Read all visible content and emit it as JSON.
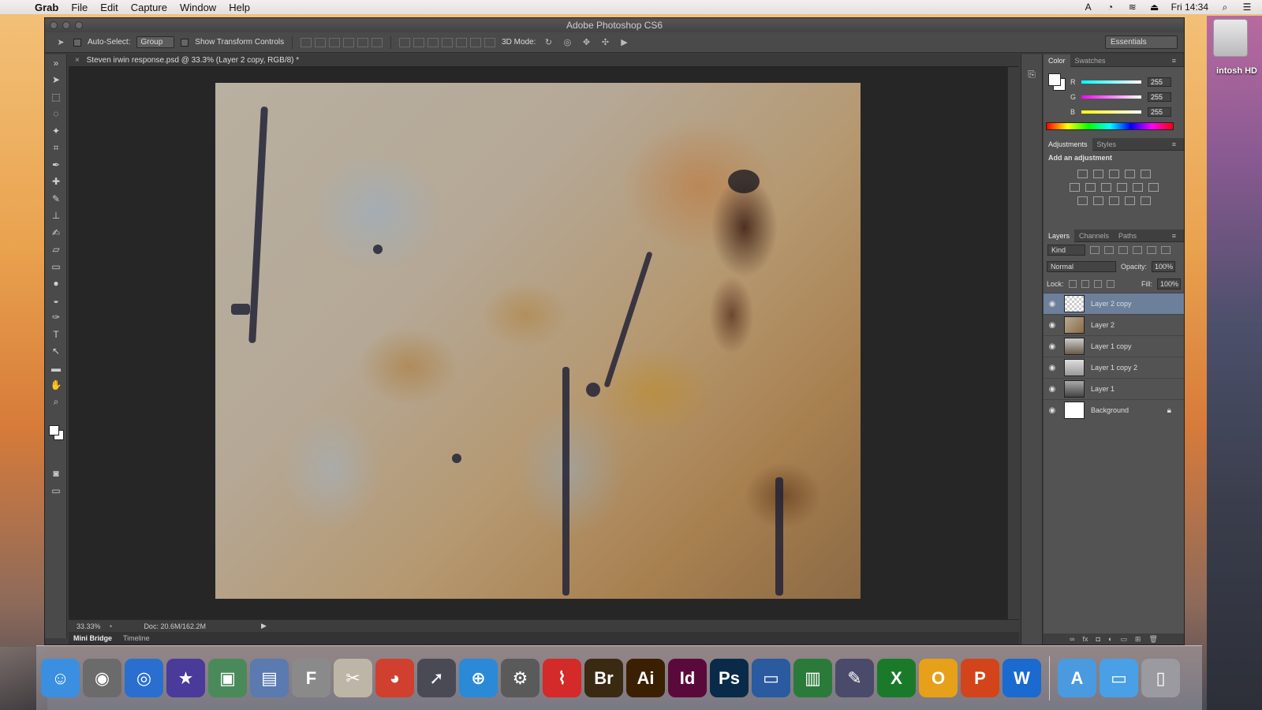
{
  "menubar": {
    "app": "Grab",
    "items": [
      "File",
      "Edit",
      "Capture",
      "Window",
      "Help"
    ],
    "clock": "Fri 14:34"
  },
  "desktop": {
    "drive_label": "intosh HD"
  },
  "window": {
    "title": "Adobe Photoshop CS6"
  },
  "options": {
    "auto_select_label": "Auto-Select:",
    "auto_select_value": "Group",
    "transform_label": "Show Transform Controls",
    "mode_3d_label": "3D Mode:",
    "workspace": "Essentials"
  },
  "document": {
    "tab_title": "Steven irwin response.psd @ 33.3% (Layer 2 copy, RGB/8) *",
    "zoom": "33.33%",
    "doc_size": "Doc: 20.6M/162.2M"
  },
  "bottom_tabs": [
    "Mini Bridge",
    "Timeline"
  ],
  "color_panel": {
    "tabs": [
      "Color",
      "Swatches"
    ],
    "channels": [
      {
        "label": "R",
        "value": "255"
      },
      {
        "label": "G",
        "value": "255"
      },
      {
        "label": "B",
        "value": "255"
      }
    ]
  },
  "adjustments_panel": {
    "tabs": [
      "Adjustments",
      "Styles"
    ],
    "title": "Add an adjustment"
  },
  "layers_panel": {
    "tabs": [
      "Layers",
      "Channels",
      "Paths"
    ],
    "kind": "Kind",
    "blend_mode": "Normal",
    "opacity_label": "Opacity:",
    "opacity": "100%",
    "lock_label": "Lock:",
    "fill_label": "Fill:",
    "fill": "100%",
    "layers": [
      {
        "name": "Layer 2 copy",
        "selected": true
      },
      {
        "name": "Layer 2",
        "selected": false
      },
      {
        "name": "Layer 1 copy",
        "selected": false
      },
      {
        "name": "Layer 1 copy 2",
        "selected": false
      },
      {
        "name": "Layer 1",
        "selected": false
      },
      {
        "name": "Background",
        "selected": false,
        "locked": true
      }
    ]
  },
  "dock": {
    "items": [
      {
        "name": "Finder",
        "glyph": "☺",
        "color": "#3b8fe0"
      },
      {
        "name": "Image Capture",
        "glyph": "◉",
        "color": "#6b6b6b"
      },
      {
        "name": "iDVD",
        "glyph": "◎",
        "color": "#2a6fcf"
      },
      {
        "name": "iMovie",
        "glyph": "★",
        "color": "#4a3a9a"
      },
      {
        "name": "iPhoto",
        "glyph": "▣",
        "color": "#4a8a5a"
      },
      {
        "name": "Preview",
        "glyph": "▤",
        "color": "#5a7ab0"
      },
      {
        "name": "Font Book",
        "glyph": "F",
        "color": "#8a8a8a"
      },
      {
        "name": "Scissors",
        "glyph": "✂",
        "color": "#bdb6a6"
      },
      {
        "name": "Chrome",
        "glyph": "◕",
        "color": "#d13f2f"
      },
      {
        "name": "Launchpad",
        "glyph": "➚",
        "color": "#4a4a55"
      },
      {
        "name": "Safari",
        "glyph": "⊕",
        "color": "#2a8ad8"
      },
      {
        "name": "System Preferences",
        "glyph": "⚙",
        "color": "#5a5a5a"
      },
      {
        "name": "Acrobat",
        "glyph": "⌇",
        "color": "#d42a2a"
      },
      {
        "name": "Bridge",
        "glyph": "Br",
        "color": "#3a2a12"
      },
      {
        "name": "Illustrator",
        "glyph": "Ai",
        "color": "#3a2000"
      },
      {
        "name": "InDesign",
        "glyph": "Id",
        "color": "#5a0a3a"
      },
      {
        "name": "Photoshop",
        "glyph": "Ps",
        "color": "#0a2a4a"
      },
      {
        "name": "Keynote",
        "glyph": "▭",
        "color": "#2a5aa0"
      },
      {
        "name": "Numbers",
        "glyph": "▥",
        "color": "#2a7a3a"
      },
      {
        "name": "Script Editor",
        "glyph": "✎",
        "color": "#4a4a6a"
      },
      {
        "name": "Excel",
        "glyph": "X",
        "color": "#1a7a2a"
      },
      {
        "name": "Outlook",
        "glyph": "O",
        "color": "#e6a01a"
      },
      {
        "name": "PowerPoint",
        "glyph": "P",
        "color": "#d4441a"
      },
      {
        "name": "Word",
        "glyph": "W",
        "color": "#1a6ad0"
      },
      {
        "name": "Applications",
        "glyph": "A",
        "color": "#4a9ae0"
      },
      {
        "name": "Documents",
        "glyph": "▭",
        "color": "#4aa0e6"
      },
      {
        "name": "Trash",
        "glyph": "▯",
        "color": "#9a9aa0"
      }
    ]
  }
}
